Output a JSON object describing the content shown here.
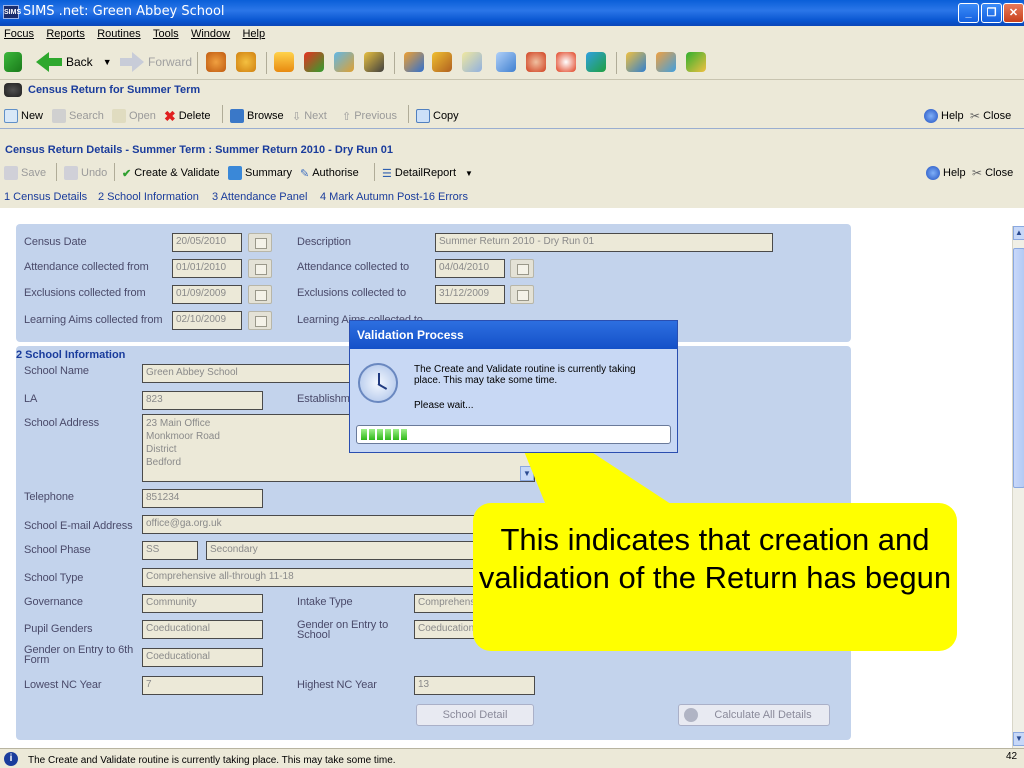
{
  "window": {
    "app_badge": "SIMS",
    "title": "SIMS .net: Green Abbey School"
  },
  "menu": [
    "Focus",
    "Reports",
    "Routines",
    "Tools",
    "Window",
    "Help"
  ],
  "nav": {
    "back": "Back",
    "forward": "Forward"
  },
  "census_return": {
    "title": "Census Return for Summer Term",
    "toolbar": {
      "new": "New",
      "search": "Search",
      "open": "Open",
      "delete": "Delete",
      "browse": "Browse",
      "next": "Next",
      "previous": "Previous",
      "copy": "Copy",
      "help": "Help",
      "close": "Close"
    }
  },
  "details": {
    "title": "Census Return Details - Summer Term : Summer Return 2010 - Dry Run 01",
    "toolbar": {
      "save": "Save",
      "undo": "Undo",
      "create_validate": "Create & Validate",
      "summary": "Summary",
      "authorise": "Authorise",
      "detail_report": "DetailReport",
      "help": "Help",
      "close": "Close"
    },
    "links": [
      "1 Census Details",
      "2 School Information",
      "3 Attendance Panel",
      "4 Mark Autumn Post-16 Errors"
    ]
  },
  "census_details": {
    "census_date_label": "Census Date",
    "census_date": "20/05/2010",
    "description_label": "Description",
    "description": "Summer Return 2010 - Dry Run 01",
    "att_from_label": "Attendance collected from",
    "att_from": "01/01/2010",
    "att_to_label": "Attendance collected to",
    "att_to": "04/04/2010",
    "exc_from_label": "Exclusions collected from",
    "exc_from": "01/09/2009",
    "exc_to_label": "Exclusions collected to",
    "exc_to": "31/12/2009",
    "la_from_label": "Learning Aims collected from",
    "la_from": "02/10/2009",
    "la_to_label": "Learning Aims collected to"
  },
  "school_info": {
    "section": "2 School Information",
    "name_label": "School Name",
    "name": "Green Abbey School",
    "la_label": "LA",
    "la": "823",
    "estab_label": "Establishment",
    "address_label": "School Address",
    "address": [
      "23    Main Office",
      "Monkmoor Road",
      "District",
      "Bedford"
    ],
    "telephone_label": "Telephone",
    "telephone": "851234",
    "email_label": "School E-mail Address",
    "email": "office@ga.org.uk",
    "phase_label": "School Phase",
    "phase_code": "SS",
    "phase": "Secondary",
    "type_label": "School Type",
    "type": "Comprehensive all-through 11-18",
    "governance_label": "Governance",
    "governance": "Community",
    "intake_label": "Intake Type",
    "intake": "Comprehensive",
    "genders_label": "Pupil Genders",
    "genders": "Coeducational",
    "gender_entry_label": "Gender on Entry to School",
    "gender_entry": "Coeducational",
    "gender_6th_label": "Gender on Entry to 6th Form",
    "gender_6th": "Coeducational",
    "lowest_label": "Lowest NC Year",
    "lowest": "7",
    "highest_label": "Highest NC Year",
    "highest": "13",
    "school_detail_btn": "School Detail",
    "calc_btn": "Calculate All Details"
  },
  "dialog": {
    "title": "Validation Process",
    "message": "The Create and Validate routine is currently taking place. This may take some time.",
    "wait": "Please wait...",
    "progress": 0.15
  },
  "callout": {
    "text": "This indicates that creation and validation of the Return has begun"
  },
  "status": {
    "text": "The Create and Validate routine is currently taking place. This may take some time.",
    "page": "42"
  }
}
